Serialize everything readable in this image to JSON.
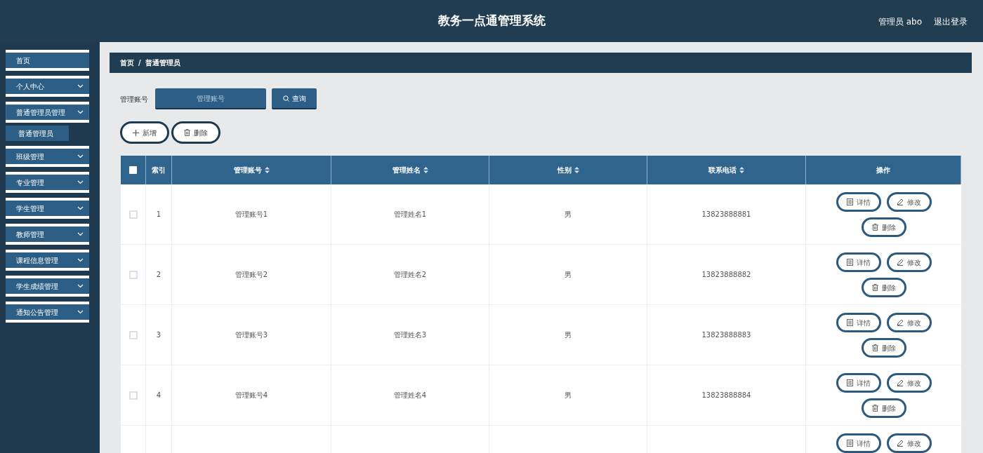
{
  "header": {
    "title": "教务一点通管理系统",
    "user": "管理员 abo",
    "logout": "退出登录"
  },
  "sidebar": {
    "items": [
      {
        "label": "首页",
        "expandable": false
      },
      {
        "label": "个人中心",
        "expandable": true,
        "expanded": false
      },
      {
        "label": "普通管理员管理",
        "expandable": true,
        "expanded": true,
        "children": [
          {
            "label": "普通管理员",
            "selected": true
          }
        ]
      },
      {
        "label": "班级管理",
        "expandable": true,
        "expanded": false
      },
      {
        "label": "专业管理",
        "expandable": true,
        "expanded": false
      },
      {
        "label": "学生管理",
        "expandable": true,
        "expanded": false
      },
      {
        "label": "教师管理",
        "expandable": true,
        "expanded": false
      },
      {
        "label": "课程信息管理",
        "expandable": true,
        "expanded": false
      },
      {
        "label": "学生成绩管理",
        "expandable": true,
        "expanded": false
      },
      {
        "label": "通知公告管理",
        "expandable": true,
        "expanded": false
      }
    ]
  },
  "breadcrumb": [
    "首页",
    "普通管理员"
  ],
  "breadcrumb_separator": "/",
  "search": {
    "label": "管理账号",
    "placeholder": "管理账号",
    "button": "查询"
  },
  "actions": [
    {
      "kind": "add",
      "label": "新增"
    },
    {
      "kind": "delete",
      "label": "删除"
    }
  ],
  "table": {
    "select_all_checked": false,
    "columns": [
      {
        "label": "索引",
        "sortable": false
      },
      {
        "label": "管理账号",
        "sortable": true
      },
      {
        "label": "管理姓名",
        "sortable": true
      },
      {
        "label": "性别",
        "sortable": true
      },
      {
        "label": "联系电话",
        "sortable": true
      },
      {
        "label": "操作",
        "sortable": false
      }
    ],
    "rows": [
      {
        "checked": false,
        "cells": [
          "1",
          "管理账号1",
          "管理姓名1",
          "男",
          "13823888881"
        ],
        "buttons": [
          {
            "kind": "detail",
            "label": "详情"
          },
          {
            "kind": "edit",
            "label": "修改"
          },
          {
            "kind": "delete",
            "label": "删除"
          }
        ]
      },
      {
        "checked": false,
        "cells": [
          "2",
          "管理账号2",
          "管理姓名2",
          "男",
          "13823888882"
        ],
        "buttons": [
          {
            "kind": "detail",
            "label": "详情"
          },
          {
            "kind": "edit",
            "label": "修改"
          },
          {
            "kind": "delete",
            "label": "删除"
          }
        ]
      },
      {
        "checked": false,
        "cells": [
          "3",
          "管理账号3",
          "管理姓名3",
          "男",
          "13823888883"
        ],
        "buttons": [
          {
            "kind": "detail",
            "label": "详情"
          },
          {
            "kind": "edit",
            "label": "修改"
          },
          {
            "kind": "delete",
            "label": "删除"
          }
        ]
      },
      {
        "checked": false,
        "cells": [
          "4",
          "管理账号4",
          "管理姓名4",
          "男",
          "13823888884"
        ],
        "buttons": [
          {
            "kind": "detail",
            "label": "详情"
          },
          {
            "kind": "edit",
            "label": "修改"
          },
          {
            "kind": "delete",
            "label": "删除"
          }
        ]
      },
      {
        "cells": [],
        "buttons": [
          {
            "kind": "detail",
            "label": "详情"
          },
          {
            "kind": "edit",
            "label": "修改"
          }
        ]
      }
    ]
  }
}
